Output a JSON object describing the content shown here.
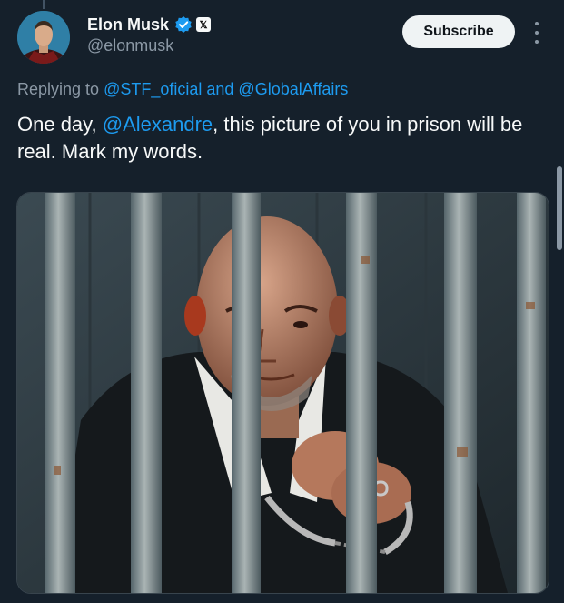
{
  "tweet": {
    "author": {
      "display_name": "Elon Musk",
      "handle": "@elonmusk",
      "verified_icon": "verified-badge-icon",
      "affiliation_icon": "x-logo-icon",
      "affiliation_glyph": "𝕏"
    },
    "subscribe_label": "Subscribe",
    "more_icon": "more-vertical-icon",
    "replying": {
      "prefix": "Replying to ",
      "mention1": "@STF_oficial",
      "conjunction": " and ",
      "mention2": "@GlobalAffairs"
    },
    "text": {
      "part1": "One day, ",
      "mention": "@Alexandre",
      "part2": ", this picture of you in prison will be real. Mark my words."
    },
    "media": {
      "type": "photo"
    }
  },
  "colors": {
    "background": "#15202b",
    "accent": "#1d9bf0",
    "secondary_text": "#8b98a5",
    "primary_text": "#f7f9f9"
  }
}
